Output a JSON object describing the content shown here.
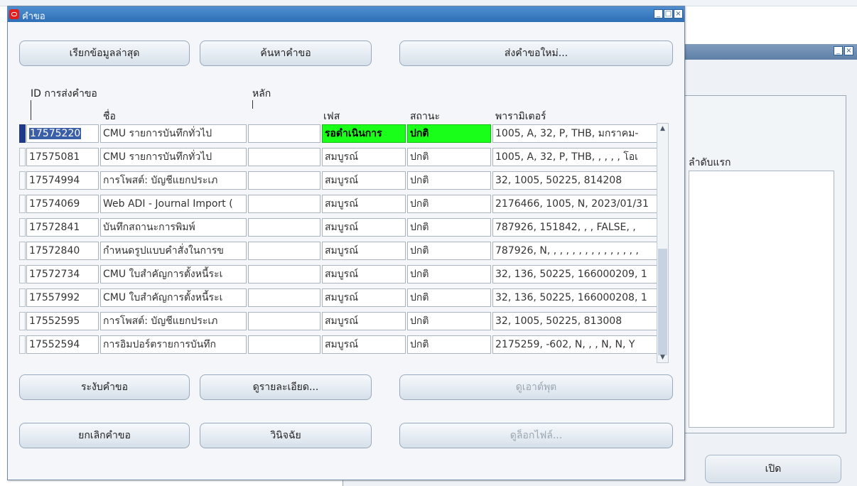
{
  "dialog": {
    "title": "คำขอ",
    "buttons": {
      "refresh": "เรียกข้อมูลล่าสุด",
      "find": "ค้นหาคำขอ",
      "submit": "ส่งคำขอใหม่...",
      "hold": "ระงับคำขอ",
      "details": "ดูรายละเอียด...",
      "output": "ดูเอาต์พุต",
      "cancel": "ยกเลิกคำขอ",
      "diagnose": "วินิจฉัย",
      "log": "ดูล็อกไฟล์..."
    },
    "columns": {
      "request_id": "ID การส่งคำขอ",
      "parent": "หลัก",
      "name": "ชื่อ",
      "phase": "เฟส",
      "status": "สถานะ",
      "parameters": "พารามิเตอร์"
    },
    "rows": [
      {
        "id": "17575220",
        "name": "CMU รายการบันทึกทั่วไป",
        "parent": "",
        "phase": "รอดำเนินการ",
        "status": "ปกติ",
        "params": "1005, A, 32, P, THB, มกราคม-"
      },
      {
        "id": "17575081",
        "name": "CMU รายการบันทึกทั่วไป",
        "parent": "",
        "phase": "สมบูรณ์",
        "status": "ปกติ",
        "params": "1005, A, 32, P, THB, , , , , โอเ"
      },
      {
        "id": "17574994",
        "name": "การโพสต์: บัญชีแยกประเภ",
        "parent": "",
        "phase": "สมบูรณ์",
        "status": "ปกติ",
        "params": "32, 1005, 50225, 814208"
      },
      {
        "id": "17574069",
        "name": "Web ADI - Journal Import (",
        "parent": "",
        "phase": "สมบูรณ์",
        "status": "ปกติ",
        "params": "2176466, 1005, N, 2023/01/31"
      },
      {
        "id": "17572841",
        "name": "บันทึกสถานะการพิมพ์",
        "parent": "",
        "phase": "สมบูรณ์",
        "status": "ปกติ",
        "params": "787926, 151842, , , FALSE, ,"
      },
      {
        "id": "17572840",
        "name": "กำหนดรูปแบบคำสั่งในการข",
        "parent": "",
        "phase": "สมบูรณ์",
        "status": "ปกติ",
        "params": "787926, N, , , , , , , , , , , , , , ,"
      },
      {
        "id": "17572734",
        "name": "CMU ใบสำคัญการตั้งหนี้ระเ",
        "parent": "",
        "phase": "สมบูรณ์",
        "status": "ปกติ",
        "params": "32, 136, 50225, 166000209, 1"
      },
      {
        "id": "17557992",
        "name": "CMU ใบสำคัญการตั้งหนี้ระเ",
        "parent": "",
        "phase": "สมบูรณ์",
        "status": "ปกติ",
        "params": "32, 136, 50225, 166000208, 1"
      },
      {
        "id": "17552595",
        "name": "การโพสต์: บัญชีแยกประเภ",
        "parent": "",
        "phase": "สมบูรณ์",
        "status": "ปกติ",
        "params": "32, 1005, 50225, 813008"
      },
      {
        "id": "17552594",
        "name": "การอิมปอร์ตรายการบันทึก",
        "parent": "",
        "phase": "สมบูรณ์",
        "status": "ปกติ",
        "params": "2175259, -602, N, , , N, N, Y"
      }
    ],
    "active_row_highlight": "#19ff19"
  },
  "background_window": {
    "label": "ลำดับแรก",
    "open_button": "เปิด"
  }
}
